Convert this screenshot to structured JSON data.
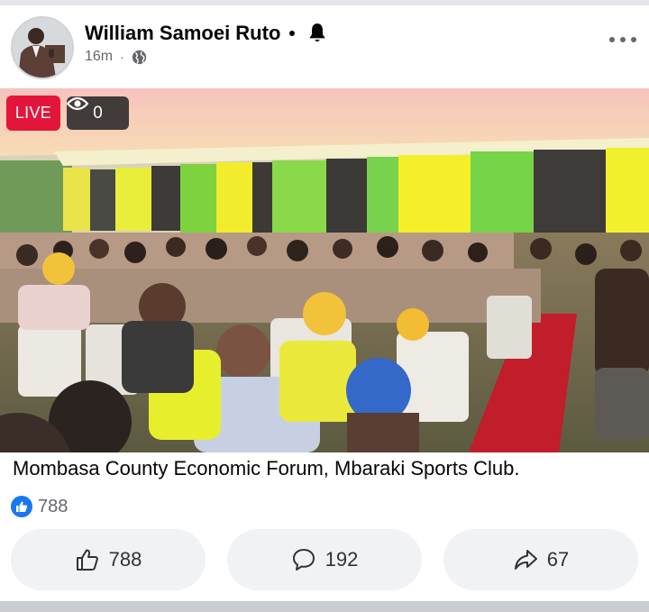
{
  "post": {
    "author": "William Samoei Ruto",
    "time": "16m",
    "caption": "Mombasa County Economic Forum, Mbaraki Sports Club."
  },
  "video": {
    "live_label": "LIVE",
    "viewer_count": "0"
  },
  "reactions": {
    "count": "788"
  },
  "actions": {
    "like_count": "788",
    "comment_count": "192",
    "share_count": "67"
  },
  "colors": {
    "live_red": "#e4153b",
    "like_blue": "#1877f2",
    "button_bg": "#f0f2f5",
    "muted_text": "#65676b"
  },
  "icons": [
    "bell-icon",
    "globe-icon",
    "more-options-icon",
    "eye-icon",
    "like-reaction-icon",
    "thumbs-up-icon",
    "comment-icon",
    "share-icon"
  ]
}
